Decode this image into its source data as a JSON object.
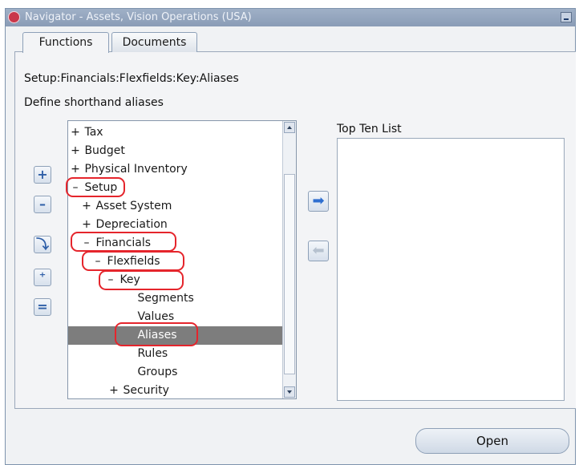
{
  "window": {
    "title": "Navigator - Assets, Vision Operations (USA)"
  },
  "tabs": [
    {
      "label": "Functions",
      "active": true
    },
    {
      "label": "Documents",
      "active": false
    }
  ],
  "path": "Setup:Financials:Flexfields:Key:Aliases",
  "description": "Define shorthand aliases",
  "tree": {
    "items": [
      {
        "glyph": "+",
        "label": "Tax",
        "level": 0
      },
      {
        "glyph": "+",
        "label": "Budget",
        "level": 0
      },
      {
        "glyph": "+",
        "label": "Physical Inventory",
        "level": 0
      },
      {
        "glyph": "–",
        "label": "Setup",
        "level": 0,
        "circled": true
      },
      {
        "glyph": "+",
        "label": "Asset System",
        "level": 1
      },
      {
        "glyph": "+",
        "label": "Depreciation",
        "level": 1
      },
      {
        "glyph": "–",
        "label": "Financials",
        "level": 1,
        "circled": true
      },
      {
        "glyph": "–",
        "label": "Flexfields",
        "level": 2,
        "circled": true
      },
      {
        "glyph": "–",
        "label": "Key",
        "level": 3,
        "circled": true
      },
      {
        "glyph": "",
        "label": "Segments",
        "level": 4
      },
      {
        "glyph": "",
        "label": "Values",
        "level": 4
      },
      {
        "glyph": "",
        "label": "Aliases",
        "level": 4,
        "selected": true,
        "circled": true
      },
      {
        "glyph": "",
        "label": "Rules",
        "level": 4
      },
      {
        "glyph": "",
        "label": "Groups",
        "level": 4
      },
      {
        "glyph": "+",
        "label": "Security",
        "level": 3
      }
    ]
  },
  "top_ten": {
    "label": "Top Ten List"
  },
  "buttons": {
    "open": "Open"
  },
  "colors": {
    "highlight_ring": "#e5252c",
    "selected_row": "#7d7d7d",
    "titlebar": "#8a9cb6"
  }
}
